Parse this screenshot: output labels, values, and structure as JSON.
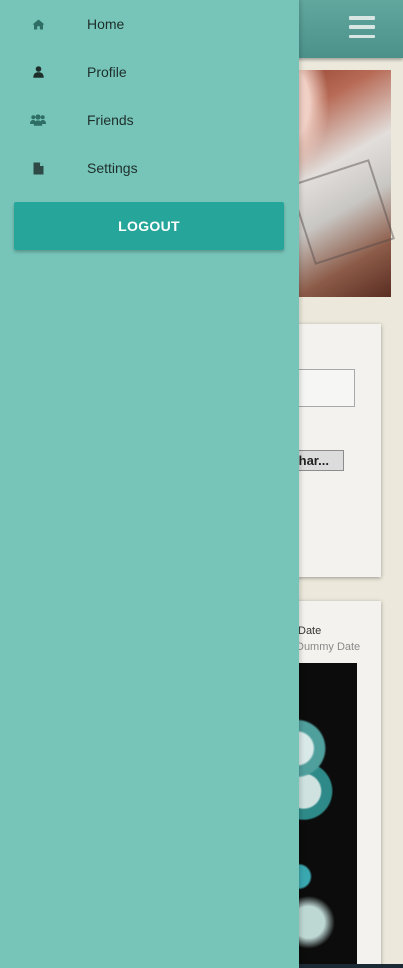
{
  "drawer": {
    "items": [
      {
        "label": "Home",
        "icon": "home-icon"
      },
      {
        "label": "Profile",
        "icon": "user-icon"
      },
      {
        "label": "Friends",
        "icon": "users-icon"
      },
      {
        "label": "Settings",
        "icon": "file-icon"
      }
    ],
    "logout_label": "LOGOUT"
  },
  "background": {
    "file_button_label": "har...",
    "post_meta": {
      "date_label": "Date",
      "date_value": "Dummy Date"
    }
  },
  "colors": {
    "drawer_bg": "#77c5b9",
    "logout_bg": "#26a69a",
    "topbar_bg": "#4b918a",
    "page_bg": "#ece9dc"
  }
}
